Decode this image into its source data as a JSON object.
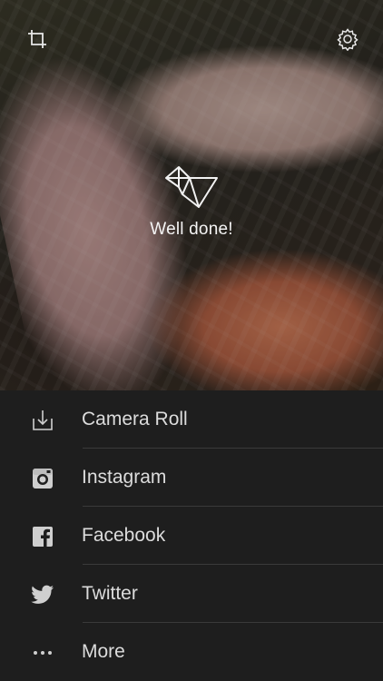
{
  "preview": {
    "status_text": "Well done!"
  },
  "toolbar": {
    "crop_icon": "crop-icon",
    "settings_icon": "gear-icon"
  },
  "share_options": [
    {
      "label": "Camera Roll",
      "icon": "download-icon"
    },
    {
      "label": "Instagram",
      "icon": "instagram-icon"
    },
    {
      "label": "Facebook",
      "icon": "facebook-icon"
    },
    {
      "label": "Twitter",
      "icon": "twitter-icon"
    },
    {
      "label": "More",
      "icon": "more-icon"
    }
  ],
  "colors": {
    "list_background": "#1e1e1e",
    "label_text": "#dcdcdc",
    "divider": "#3a3a3a"
  }
}
